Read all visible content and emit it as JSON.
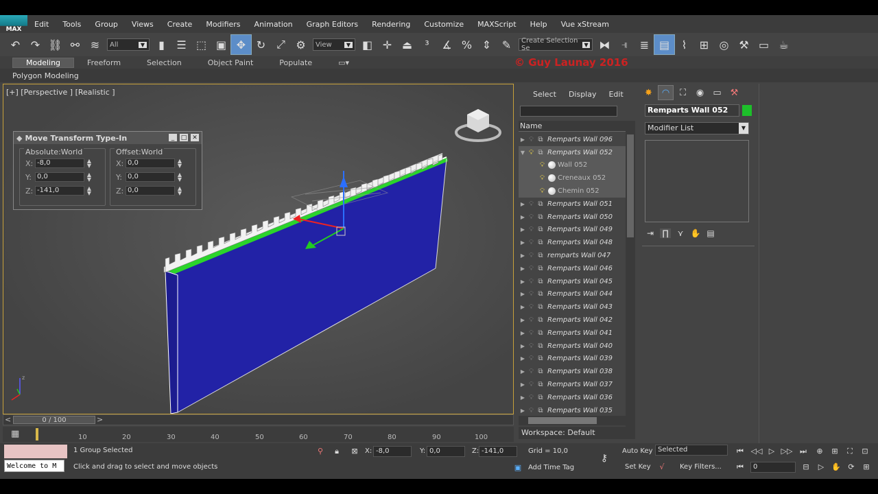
{
  "menubar": {
    "logo": "MAX",
    "items": [
      "Edit",
      "Tools",
      "Group",
      "Views",
      "Create",
      "Modifiers",
      "Animation",
      "Graph Editors",
      "Rendering",
      "Customize",
      "MAXScript",
      "Help",
      "Vue xStream"
    ]
  },
  "toolbar": {
    "filter_value": "All",
    "ref_coord_value": "View",
    "selection_set_placeholder": "Create Selection Se"
  },
  "ribbon": {
    "tabs": [
      "Modeling",
      "Freeform",
      "Selection",
      "Object Paint",
      "Populate"
    ],
    "active": "Modeling",
    "subpanel": "Polygon Modeling"
  },
  "watermark": "© Guy Launay 2016",
  "viewport": {
    "label": "[+] [Perspective ] [Realistic ]",
    "wall_color": "#2424a0"
  },
  "dialog": {
    "title": "Move Transform Type-In",
    "absolute": {
      "label": "Absolute:World",
      "x": "-8,0",
      "y": "0,0",
      "z": "-141,0"
    },
    "offset": {
      "label": "Offset:World",
      "x": "0,0",
      "y": "0,0",
      "z": "0,0"
    }
  },
  "timeslider": {
    "value": "0 / 100",
    "prev": "<",
    "next": ">"
  },
  "trackbar": {
    "ticks": [
      "10",
      "20",
      "30",
      "40",
      "50",
      "60",
      "70",
      "80",
      "90",
      "100"
    ]
  },
  "explorer": {
    "tabs": [
      "Select",
      "Display",
      "Edit"
    ],
    "column": "Name",
    "items": [
      {
        "name": "Remparts Wall 096",
        "level": 0,
        "expanded": false
      },
      {
        "name": "Remparts Wall 052",
        "level": 0,
        "expanded": true,
        "selected": true
      },
      {
        "name": "Wall 052",
        "level": 1
      },
      {
        "name": "Creneaux 052",
        "level": 1
      },
      {
        "name": "Chemin 052",
        "level": 1
      },
      {
        "name": "Remparts Wall 051",
        "level": 0
      },
      {
        "name": "Remparts Wall 050",
        "level": 0
      },
      {
        "name": "Remparts Wall 049",
        "level": 0
      },
      {
        "name": "Remparts Wall 048",
        "level": 0
      },
      {
        "name": "remparts Wall 047",
        "level": 0
      },
      {
        "name": "Remparts Wall 046",
        "level": 0
      },
      {
        "name": "Remparts Wall 045",
        "level": 0
      },
      {
        "name": "Remparts Wall 044",
        "level": 0
      },
      {
        "name": "Remparts Wall 043",
        "level": 0
      },
      {
        "name": "Remparts Wall 042",
        "level": 0
      },
      {
        "name": "Remparts Wall 041",
        "level": 0
      },
      {
        "name": "Remparts Wall 040",
        "level": 0
      },
      {
        "name": "Remparts Wall 039",
        "level": 0
      },
      {
        "name": "Remparts Wall 038",
        "level": 0
      },
      {
        "name": "Remparts Wall 037",
        "level": 0
      },
      {
        "name": "Remparts Wall 036",
        "level": 0
      },
      {
        "name": "Remparts Wall 035",
        "level": 0
      }
    ],
    "workspace": "Workspace: Default"
  },
  "command_panel": {
    "object_name": "Remparts Wall 052",
    "object_color": "#1dc02a",
    "modifier_list": "Modifier List"
  },
  "status": {
    "selection": "1 Group Selected",
    "prompt": "Click and drag to select and move objects",
    "listener": "Welcome to M",
    "x": "-8,0",
    "y": "0,0",
    "z": "-141,0",
    "x_label": "X:",
    "y_label": "Y:",
    "z_label": "Z:",
    "grid": "Grid = 10,0",
    "add_time_tag": "Add Time Tag",
    "auto_key": "Auto Key",
    "set_key": "Set Key",
    "selected_value": "Selected",
    "key_filters": "Key Filters...",
    "frame": "0"
  }
}
